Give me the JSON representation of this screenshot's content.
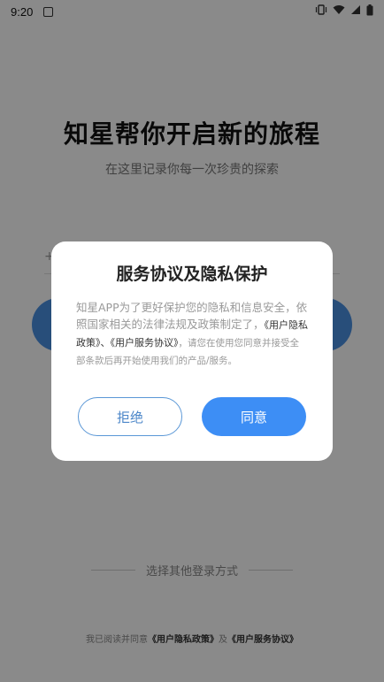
{
  "status_bar": {
    "time": "9:20",
    "notification_icon": "app-notification-icon",
    "right_icons": [
      "vibrate-icon",
      "wifi-icon",
      "signal-icon",
      "battery-icon"
    ]
  },
  "login": {
    "title": "知星帮你开启新的旅程",
    "subtitle": "在这里记录你每一次珍贵的探索",
    "phone_prefix": "+",
    "other_login": "选择其他登录方式",
    "agreement_prefix": "我已阅读并同意",
    "privacy_link": "《用户隐私政策》",
    "agreement_join": "及",
    "service_link": "《用户服务协议》"
  },
  "dialog": {
    "title": "服务协议及隐私保护",
    "body_line1": "知星APP为了更好保护您的隐私和信息安全，依照国家相关的法律法规及政策制定了，",
    "privacy_link": "《用户隐私政策》",
    "separator": "、",
    "service_link": "《用户服务协议》",
    "body_line2": "，请您在使用您同意并接受全部条款后再开始使用我们的产品/服务。",
    "reject_label": "拒绝",
    "agree_label": "同意"
  },
  "colors": {
    "accent": "#3d8ef5",
    "overlay": "rgba(0,0,0,0.46)"
  }
}
